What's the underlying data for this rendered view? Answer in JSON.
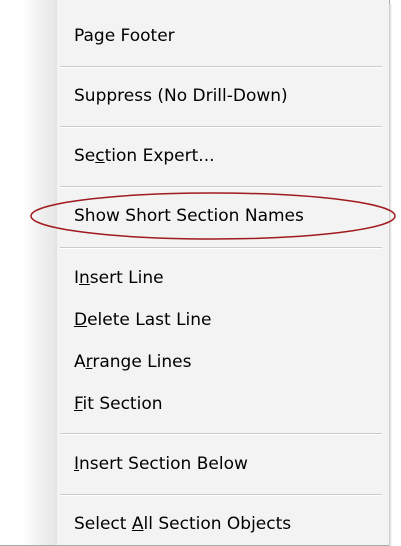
{
  "menu": {
    "items": [
      {
        "id": "page-footer",
        "before": "Page Footer",
        "u": "",
        "after": ""
      },
      {
        "id": "suppress",
        "before": "Suppress (No Drill-Down)",
        "u": "",
        "after": ""
      },
      {
        "id": "section-expert",
        "before": "Se",
        "u": "c",
        "after": "tion Expert..."
      },
      {
        "id": "show-short-section-names",
        "before": "Show Short Section Names",
        "u": "",
        "after": ""
      },
      {
        "id": "insert-line",
        "before": "I",
        "u": "n",
        "after": "sert Line"
      },
      {
        "id": "delete-last-line",
        "before": "",
        "u": "D",
        "after": "elete Last Line"
      },
      {
        "id": "arrange-lines",
        "before": "A",
        "u": "r",
        "after": "range Lines"
      },
      {
        "id": "fit-section",
        "before": "",
        "u": "F",
        "after": "it Section"
      },
      {
        "id": "insert-section-below",
        "before": "",
        "u": "I",
        "after": "nsert Section Below"
      },
      {
        "id": "select-all-section-objects",
        "before": "Select ",
        "u": "A",
        "after": "ll Section Objects"
      }
    ]
  },
  "annotation": {
    "highlight_color": "#a01a1f",
    "highlighted_item": "Show Short Section Names"
  }
}
